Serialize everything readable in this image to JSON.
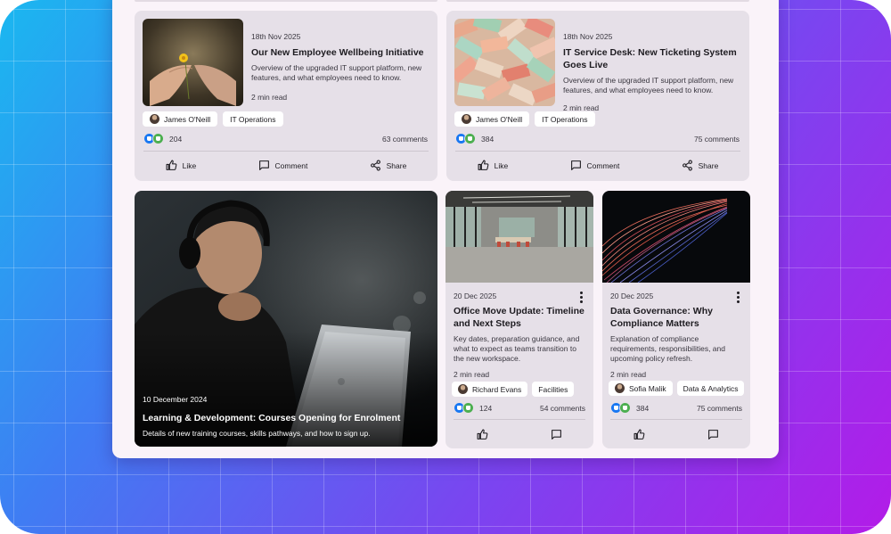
{
  "feed": {
    "top_cards": [
      {
        "date": "18th Nov 2025",
        "title": "Our New Employee Wellbeing Initiative",
        "desc": "Overview of the upgraded IT support platform, new features, and what employees need to know.",
        "read": "2 min read",
        "author": "James O'Neill",
        "tag": "IT Operations",
        "reactions": "204",
        "comments": "63 comments",
        "image": "hands-holding-flower"
      },
      {
        "date": "18th Nov 2025",
        "title": "IT Service Desk: New Ticketing System Goes Live",
        "desc": "Overview of the upgraded IT support platform, new features, and what employees need to know.",
        "read": "2 min read",
        "author": "James O'Neill",
        "tag": "IT Operations",
        "reactions": "384",
        "comments": "75 comments",
        "image": "pile-of-tickets"
      }
    ],
    "actions": {
      "like": "Like",
      "comment": "Comment",
      "share": "Share"
    },
    "hero": {
      "date": "10 December 2024",
      "title": "Learning & Development: Courses Opening for Enrolment",
      "desc": "Details of new training courses, skills pathways, and how to sign up.",
      "image": "man-with-headphones-laptop"
    },
    "small_cards": [
      {
        "date": "20 Dec 2025",
        "title": "Office Move Update: Timeline and Next Steps",
        "desc": "Key dates, preparation guidance, and what to expect as teams transition to the new workspace.",
        "read": "2 min read",
        "author": "Richard Evans",
        "tag": "Facilities",
        "reactions": "124",
        "comments": "54 comments",
        "image": "empty-office"
      },
      {
        "date": "20 Dec 2025",
        "title": "Data Governance: Why Compliance Matters",
        "desc": "Explanation of compliance requirements, responsibilities, and upcoming policy refresh.",
        "read": "2 min read",
        "author": "Sofia Malik",
        "tag": "Data & Analytics",
        "reactions": "384",
        "comments": "75 comments",
        "image": "fiber-optic-lines"
      }
    ]
  },
  "colors": {
    "like": "#1877f2",
    "celebrate": "#4caf50",
    "card_bg": "#e6e0e8",
    "panel_bg": "#faf3f9"
  }
}
